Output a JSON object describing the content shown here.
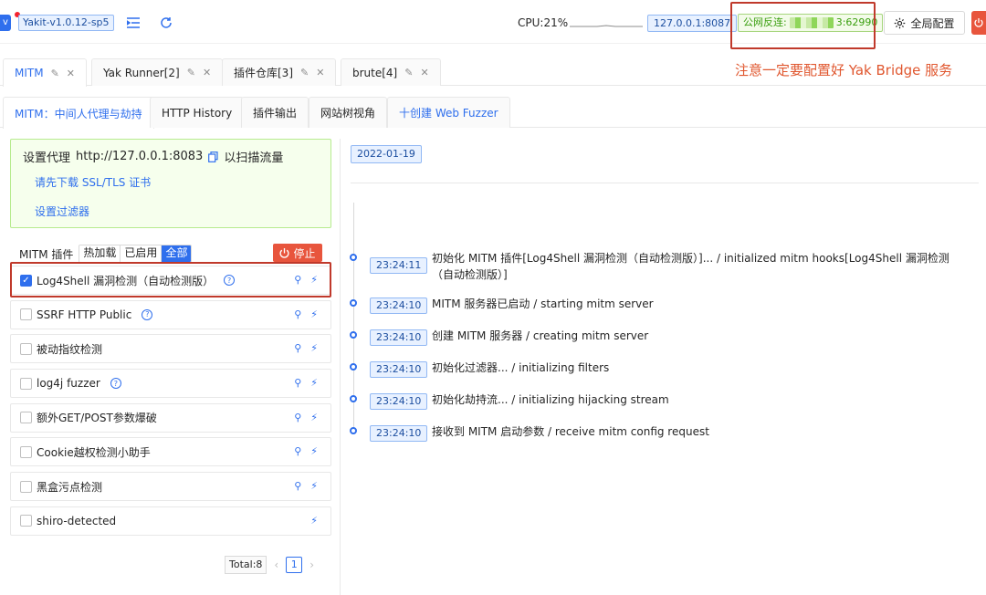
{
  "topbar": {
    "logo_glyph": "v",
    "version": "Yakit-v1.0.12-sp5",
    "cpu": "CPU:21%",
    "engine_addr": "127.0.0.1:8087",
    "bridge_prefix": "公网反连:",
    "bridge_port": "3:62990",
    "global_config": "全局配置",
    "icons": [
      "menu-fold-icon",
      "reload-icon",
      "gear-icon",
      "power-icon"
    ]
  },
  "tabs": [
    {
      "label": "MITM",
      "active": true
    },
    {
      "label": "Yak Runner[2]",
      "active": false
    },
    {
      "label": "插件仓库[3]",
      "active": false
    },
    {
      "label": "brute[4]",
      "active": false
    }
  ],
  "annotation_note": "注意一定要配置好 Yak Bridge 服务",
  "subtabs": [
    {
      "label": "MITM：中间人代理与劫持",
      "active": true
    },
    {
      "label": "HTTP History",
      "active": false
    },
    {
      "label": "插件输出",
      "active": false
    },
    {
      "label": "网站树视角",
      "active": false
    },
    {
      "label": "十创建 Web Fuzzer",
      "active": false
    }
  ],
  "proxy": {
    "prefix": "设置代理",
    "address": "http://127.0.0.1:8083",
    "suffix": "以扫描流量",
    "download_cert": "请先下载 SSL/TLS 证书",
    "set_filter": "设置过滤器"
  },
  "plugins": {
    "header_label": "MITM 插件",
    "filters": [
      "热加载",
      "已启用",
      "全部"
    ],
    "active_filter": 2,
    "stop_label": "停止",
    "items": [
      {
        "name": "Log4Shell 漏洞检测（自动检测版）",
        "checked": true,
        "help": true,
        "user_icon": true
      },
      {
        "name": "SSRF HTTP Public",
        "checked": false,
        "help": true,
        "user_icon": true
      },
      {
        "name": "被动指纹检测",
        "checked": false,
        "help": false,
        "user_icon": true
      },
      {
        "name": "log4j fuzzer",
        "checked": false,
        "help": true,
        "user_icon": true
      },
      {
        "name": "额外GET/POST参数爆破",
        "checked": false,
        "help": false,
        "user_icon": true
      },
      {
        "name": "Cookie越权检测小助手",
        "checked": false,
        "help": false,
        "user_icon": true
      },
      {
        "name": "黑盒污点检测",
        "checked": false,
        "help": false,
        "user_icon": true
      },
      {
        "name": "shiro-detected",
        "checked": false,
        "help": false,
        "user_icon": false
      }
    ],
    "total": "Total:8",
    "page": "1"
  },
  "log": {
    "date": "2022-01-19",
    "entries": [
      {
        "time": "23:24:11",
        "message": "初始化 MITM 插件[Log4Shell 漏洞检测（自动检测版）]... / initialized mitm hooks[Log4Shell 漏洞检测（自动检测版）]"
      },
      {
        "time": "23:24:10",
        "message": "MITM 服务器已启动 / starting mitm server"
      },
      {
        "time": "23:24:10",
        "message": "创建 MITM 服务器 / creating mitm server"
      },
      {
        "time": "23:24:10",
        "message": "初始化过滤器... / initializing filters"
      },
      {
        "time": "23:24:10",
        "message": "初始化劫持流... / initializing hijacking stream"
      },
      {
        "time": "23:24:10",
        "message": "接收到 MITM 启动参数 / receive mitm config request"
      }
    ]
  },
  "colors": {
    "accent": "#2f6fed",
    "danger": "#e8553d",
    "annotation": "#c0392b"
  }
}
